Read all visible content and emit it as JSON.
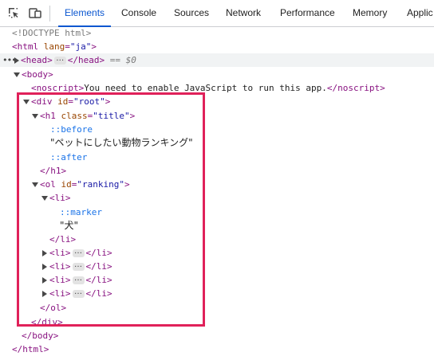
{
  "toolbar": {
    "tabs": [
      {
        "label": "Elements",
        "active": true
      },
      {
        "label": "Console",
        "active": false
      },
      {
        "label": "Sources",
        "active": false
      },
      {
        "label": "Network",
        "active": false
      },
      {
        "label": "Performance",
        "active": false
      },
      {
        "label": "Memory",
        "active": false
      },
      {
        "label": "Applic",
        "active": false
      }
    ],
    "icons": [
      "inspect-element-icon",
      "device-toolbar-icon"
    ],
    "accent_color": "#0b57d0"
  },
  "dom": {
    "doctype": "<!DOCTYPE html>",
    "html_open": {
      "tag": "<html",
      "attr": "lang",
      "val": "\"ja\"",
      "close": ">"
    },
    "head": {
      "open": "<head>",
      "close": "</head>",
      "eq": "== $0"
    },
    "body_open": "<body>",
    "noscript": {
      "open": "<noscript>",
      "text": "You need to enable JavaScript to run this app.",
      "close": "</noscript>"
    },
    "div_root": {
      "tag": "<div",
      "attr": "id",
      "val": "\"root\"",
      "close": ">"
    },
    "h1": {
      "tag": "<h1",
      "attr": "class",
      "val": "\"title\"",
      "close": ">"
    },
    "before": "::before",
    "h1_text": "\"ペットにしたい動物ランキング\"",
    "after": "::after",
    "h1_close": "</h1>",
    "ol": {
      "tag": "<ol",
      "attr": "id",
      "val": "\"ranking\"",
      "close": ">"
    },
    "li_open": "<li>",
    "marker": "::marker",
    "li_text": "\"犬\"",
    "li_close": "</li>",
    "collapsed_li": [
      {
        "open": "<li>",
        "close": "</li>"
      },
      {
        "open": "<li>",
        "close": "</li>"
      },
      {
        "open": "<li>",
        "close": "</li>"
      },
      {
        "open": "<li>",
        "close": "</li>"
      }
    ],
    "ol_close": "</ol>",
    "div_close": "</div>",
    "body_close": "</body>",
    "html_close": "</html>"
  },
  "highlight_color": "#e0215a"
}
